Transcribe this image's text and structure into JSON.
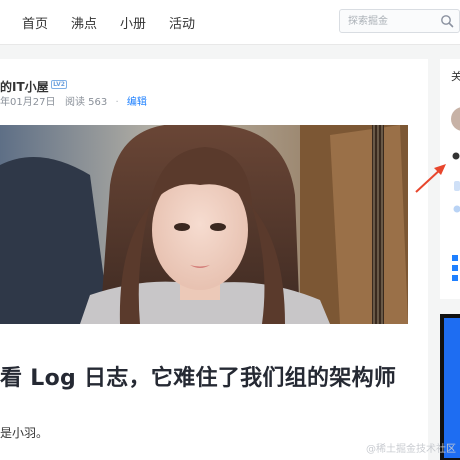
{
  "nav": {
    "items": [
      {
        "label": "首页"
      },
      {
        "label": "沸点"
      },
      {
        "label": "小册"
      },
      {
        "label": "活动"
      }
    ],
    "search": {
      "placeholder": "探索掘金",
      "icon": "search-icon"
    }
  },
  "article": {
    "author_name": "的IT小屋",
    "level_badge": "LV2",
    "date": "年01月27日",
    "views": "阅读 563",
    "separator": "·",
    "edit_label": "编辑",
    "title": "看 Log 日志，它难住了我们组的架构师",
    "paragraph": "是小羽。"
  },
  "sidebar": {
    "heading": "关"
  },
  "annotation": {
    "arrow_color": "#e8462d"
  },
  "watermark": "@稀土掘金技术社区",
  "colors": {
    "accent": "#1e80ff",
    "page_bg": "#f4f5f5"
  }
}
